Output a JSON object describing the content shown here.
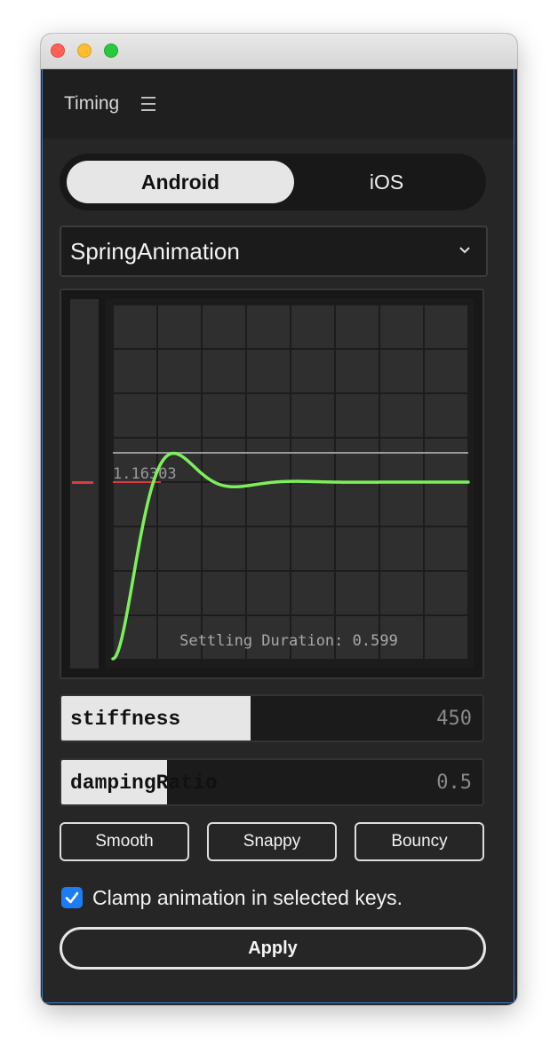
{
  "panel": {
    "title": "Timing"
  },
  "platform_tabs": [
    {
      "label": "Android",
      "selected": true
    },
    {
      "label": "iOS",
      "selected": false
    }
  ],
  "animation_type": {
    "selected": "SpringAnimation"
  },
  "graph": {
    "peak_value_label": "1.16303",
    "settling_label": "Settling Duration: 0.599",
    "curve_color": "#7cf05a",
    "marker_color": "#e0393e"
  },
  "sliders": {
    "stiffness": {
      "label": "stiffness",
      "value": "450",
      "fill_fraction": 0.45
    },
    "damping": {
      "label": "dampingRatio",
      "value": "0.5",
      "fill_fraction": 0.25
    }
  },
  "presets": [
    "Smooth",
    "Snappy",
    "Bouncy"
  ],
  "clamp": {
    "label": "Clamp animation in selected keys.",
    "checked": true
  },
  "apply_label": "Apply"
}
